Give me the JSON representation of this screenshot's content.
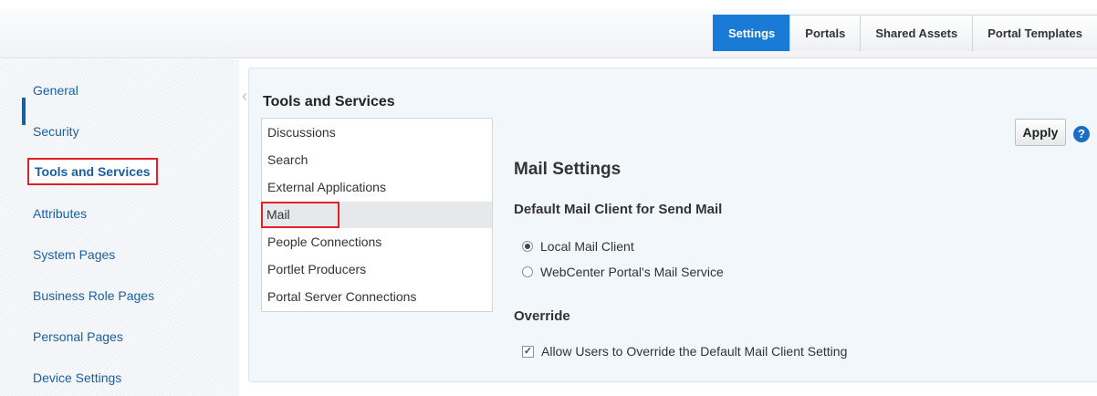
{
  "top_tabs": [
    {
      "label": "Settings",
      "active": true
    },
    {
      "label": "Portals",
      "active": false
    },
    {
      "label": "Shared Assets",
      "active": false
    },
    {
      "label": "Portal Templates",
      "active": false
    }
  ],
  "sidebar": {
    "items": [
      {
        "label": "General"
      },
      {
        "label": "Security"
      },
      {
        "label": "Tools and Services",
        "selected": true
      },
      {
        "label": "Attributes"
      },
      {
        "label": "System Pages"
      },
      {
        "label": "Business Role Pages"
      },
      {
        "label": "Personal Pages"
      },
      {
        "label": "Device Settings"
      }
    ]
  },
  "tools": {
    "title": "Tools and Services",
    "items": [
      {
        "label": "Discussions"
      },
      {
        "label": "Search"
      },
      {
        "label": "External Applications"
      },
      {
        "label": "Mail",
        "selected": true
      },
      {
        "label": "People Connections"
      },
      {
        "label": "Portlet Producers"
      },
      {
        "label": "Portal Server Connections"
      }
    ]
  },
  "mail": {
    "apply_label": "Apply",
    "help_glyph": "?",
    "heading": "Mail Settings",
    "default_client_heading": "Default Mail Client for Send Mail",
    "options": [
      {
        "label": "Local Mail Client",
        "checked": true
      },
      {
        "label": "WebCenter Portal's Mail Service",
        "checked": false
      }
    ],
    "override_heading": "Override",
    "override_checkbox_label": "Allow Users to Override the Default Mail Client Setting",
    "override_checked": true
  },
  "colors": {
    "accent": "#1a7bd6",
    "highlight_box": "#e0202a",
    "link": "#1a5f9e"
  },
  "icons": {
    "collapse": "chevron-left-icon",
    "help": "help-icon"
  }
}
